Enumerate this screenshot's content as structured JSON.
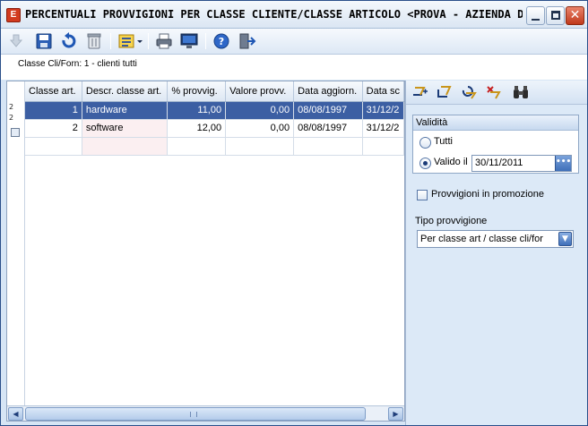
{
  "window": {
    "app_icon_letter": "E",
    "title": "PERCENTUALI PROVVIGIONI PER CLASSE CLIENTE/CLASSE ARTICOLO <PROVA - AZIENDA D...",
    "minimize_glyph": "",
    "maximize_glyph": "",
    "close_glyph": "✕"
  },
  "toolbar": {
    "icons": [
      "new-disabled-icon",
      "save-icon",
      "undo-icon",
      "delete-icon",
      "layout-dropdown-icon",
      "print-icon",
      "preview-icon",
      "help-icon",
      "exit-icon"
    ]
  },
  "header": {
    "classe_label": "Classe Cli/Forn: 1 - clienti tutti"
  },
  "row_indicator": {
    "top_values": [
      "2",
      "2"
    ]
  },
  "grid": {
    "columns": [
      "Classe art.",
      "Descr. classe art.",
      "% provvig.",
      "Valore provv.",
      "Data aggiorn.",
      "Data sc"
    ],
    "rows": [
      {
        "classe": "1",
        "descr": "hardware",
        "provvig": "11,00",
        "valore": "0,00",
        "aggiorn": "08/08/1997",
        "scad": "31/12/2"
      },
      {
        "classe": "2",
        "descr": "software",
        "provvig": "12,00",
        "valore": "0,00",
        "aggiorn": "08/08/1997",
        "scad": "31/12/2"
      }
    ],
    "scroll_left": "◀",
    "scroll_right": "▶"
  },
  "right_panel": {
    "tool_icons": [
      "insert-row-icon",
      "edit-row-icon",
      "undo-row-icon",
      "delete-row-icon",
      "search-binoculars-icon"
    ],
    "validita": {
      "title": "Validità",
      "option_tutti": "Tutti",
      "option_valido": "Valido il",
      "date_value": "30/11/2011",
      "date_btn": "•••"
    },
    "promo_label": "Provvigioni in promozione",
    "tipo_label": "Tipo provvigione",
    "tipo_value": "Per classe art / classe cli/for",
    "combo_arrow": "▼"
  },
  "colors": {
    "selection": "#3c5fa3",
    "window_bg": "#d6e5f5",
    "close_btn": "#c0391b"
  }
}
